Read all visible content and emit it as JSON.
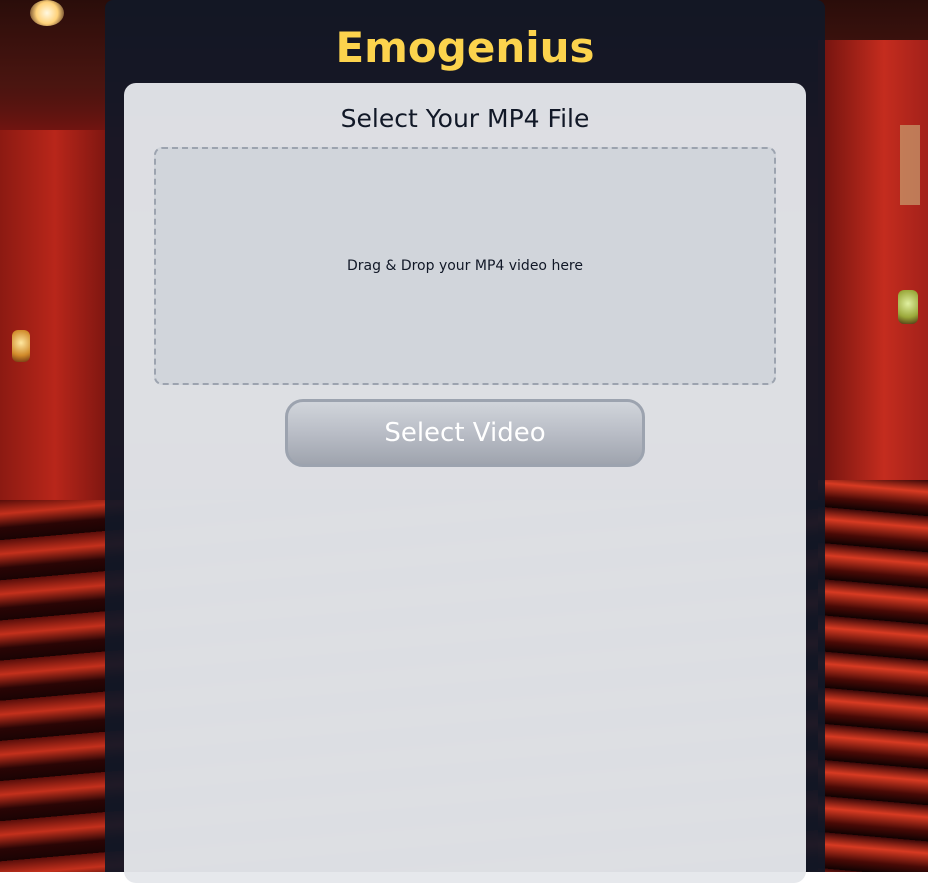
{
  "app": {
    "title": "Emogenius"
  },
  "upload_card": {
    "heading": "Select Your MP4 File",
    "drop_zone_text": "Drag & Drop your MP4 video here",
    "select_button_label": "Select Video"
  },
  "background": {
    "description_icon": "movie-theater-background"
  },
  "colors": {
    "title": "#fcd34d",
    "panel": "#111827",
    "card": "#e5e7eb",
    "drop_zone": "#d1d5db",
    "button_text": "#ffffff"
  }
}
